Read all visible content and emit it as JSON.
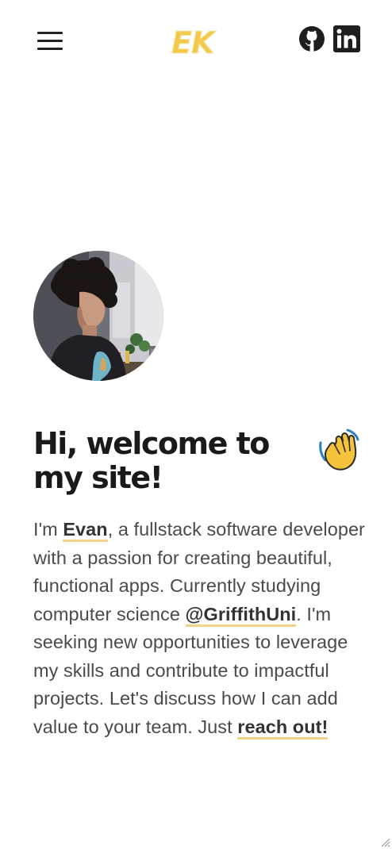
{
  "header": {
    "logo_text": "EK",
    "menu_icon": "hamburger-menu-icon",
    "social": [
      {
        "name": "github-icon",
        "label": "GitHub"
      },
      {
        "name": "linkedin-icon",
        "label": "LinkedIn"
      }
    ]
  },
  "avatar": {
    "alt": "Evan profile photo"
  },
  "hero": {
    "title": "Hi, welcome to my site!",
    "wave_icon": "waving-hand-icon",
    "intro": {
      "p1": "I'm ",
      "name_link": "Evan",
      "p2": ", a fullstack software developer with a passion for creating beautiful, functional apps. Currently studying computer science ",
      "uni_link": "@GriffithUni",
      "p3": ". I'm seeking new opportunities to leverage my skills and contribute to impactful projects. Let's discuss how I can add value to your team. Just ",
      "contact_link": "reach out!"
    }
  },
  "colors": {
    "accent": "#f3d28a",
    "logo_yellow": "#f2c94c",
    "text": "#4a4a4a",
    "heading": "#1a1a1a"
  }
}
